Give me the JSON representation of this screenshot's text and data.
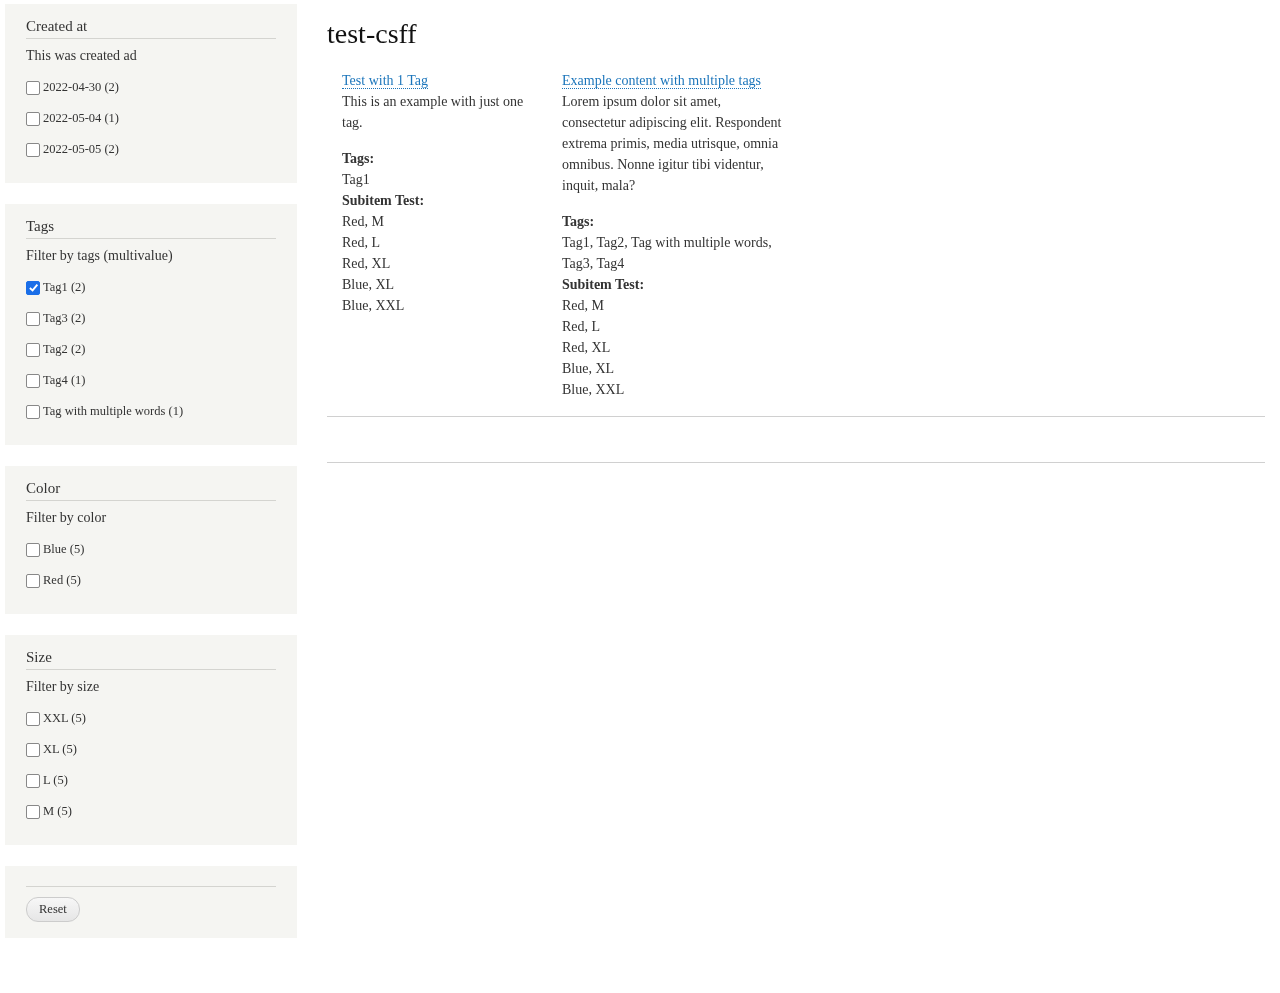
{
  "facets": [
    {
      "title": "Created at",
      "label": "This was created ad",
      "options": [
        {
          "label": "2022-04-30 (2)",
          "checked": false
        },
        {
          "label": "2022-05-04 (1)",
          "checked": false
        },
        {
          "label": "2022-05-05 (2)",
          "checked": false
        }
      ]
    },
    {
      "title": "Tags",
      "label": "Filter by tags (multivalue)",
      "options": [
        {
          "label": "Tag1 (2)",
          "checked": true
        },
        {
          "label": "Tag3 (2)",
          "checked": false
        },
        {
          "label": "Tag2 (2)",
          "checked": false
        },
        {
          "label": "Tag4 (1)",
          "checked": false
        },
        {
          "label": "Tag with multiple words (1)",
          "checked": false
        }
      ]
    },
    {
      "title": "Color",
      "label": "Filter by color",
      "options": [
        {
          "label": "Blue (5)",
          "checked": false
        },
        {
          "label": "Red (5)",
          "checked": false
        }
      ]
    },
    {
      "title": "Size",
      "label": "Filter by size",
      "options": [
        {
          "label": "XXL (5)",
          "checked": false
        },
        {
          "label": "XL (5)",
          "checked": false
        },
        {
          "label": "L (5)",
          "checked": false
        },
        {
          "label": "M (5)",
          "checked": false
        }
      ]
    }
  ],
  "reset_button": "Reset",
  "page_title": "test-csff",
  "results": [
    {
      "title": "Test with 1 Tag",
      "body": "This is an example with just one tag.",
      "tags_label": "Tags:",
      "tags": "Tag1",
      "subitem_label": "Subitem Test:",
      "subitems": [
        "Red, M",
        "Red, L",
        "Red, XL",
        "Blue, XL",
        "Blue, XXL"
      ]
    },
    {
      "title": "Example content with multiple tags",
      "body": "Lorem ipsum dolor sit amet, consectetur adipiscing elit. Respondent extrema primis, media utrisque, omnia omnibus. Nonne igitur tibi videntur, inquit, mala?",
      "tags_label": "Tags:",
      "tags": "Tag1, Tag2, Tag with multiple words, Tag3, Tag4",
      "subitem_label": "Subitem Test:",
      "subitems": [
        "Red, M",
        "Red, L",
        "Red, XL",
        "Blue, XL",
        "Blue, XXL"
      ]
    }
  ]
}
